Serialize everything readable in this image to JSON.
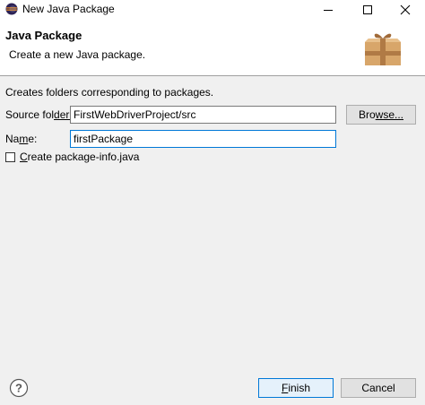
{
  "window": {
    "title": "New Java Package"
  },
  "header": {
    "title": "Java Package",
    "description": "Create a new Java package."
  },
  "form": {
    "info": "Creates folders corresponding to packages.",
    "source_folder": {
      "label_mnemonic": "Source fol",
      "label_rest": "der:",
      "value": "FirstWebDriverProject/src"
    },
    "browse": {
      "label_mnemonic": "Bro",
      "label_rest": "wse..."
    },
    "name": {
      "label_pre": "Na",
      "label_mnemonic": "m",
      "label_rest": "e:",
      "value": "firstPackage"
    },
    "create_package_info": {
      "label_mnemonic": "C",
      "label_rest": "reate package-info.java",
      "checked": false
    }
  },
  "footer": {
    "finish": {
      "label_mnemonic": "F",
      "label_rest": "inish"
    },
    "cancel": {
      "label": "Cancel"
    }
  },
  "icons": {
    "app": "eclipse-icon",
    "help": "help-icon",
    "header": "package-box-icon"
  },
  "colors": {
    "accent": "#0078d7",
    "background": "#f0f0f0",
    "header_background": "#ffffff"
  }
}
